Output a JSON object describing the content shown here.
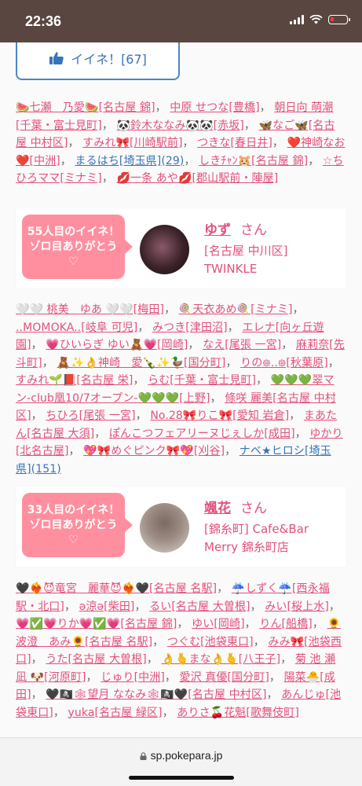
{
  "status": {
    "time": "22:36"
  },
  "like_button": {
    "label": "イイネ！[67]"
  },
  "list1": [
    {
      "text": "🍉七瀬　乃愛🍉[名古屋 錦]"
    },
    {
      "text": "中原 せつな[豊橋]"
    },
    {
      "text": "朝日向 萌潮[千葉・富士見町]"
    },
    {
      "text": "🐼鈴木ななみ🐼🐼[赤坂]"
    },
    {
      "text": "🦋なご🦋[名古屋 中村区]"
    },
    {
      "text": "すみれ🎀[川崎駅前]"
    },
    {
      "text": "つきな[春日井]"
    },
    {
      "text": "❤️神崎なお❤️[中洲]"
    },
    {
      "text": "まるはち[埼玉県](29)",
      "blue": true
    },
    {
      "text": "しきﾁｬﾝ🐹[名古屋 錦]"
    },
    {
      "text": "☆ちひろママ[ミナミ]"
    },
    {
      "text": "💋一条 あや💋[郡山駅前・陣屋]"
    }
  ],
  "card1": {
    "badge_line1": "55人目のイイネ！",
    "badge_line2": "ゾロ目ありがとう",
    "badge_heart": "♡",
    "name": "ゆず",
    "suffix": "さん",
    "shop": "[名古屋 中川区] TWINKLE"
  },
  "list2": [
    {
      "text": "🤍🤍 桃美　ゆあ 🤍🤍[梅田]"
    },
    {
      "text": "🍭天衣あめ🍭[ミナミ]"
    },
    {
      "text": "..MOMOKA..[岐阜 可児]"
    },
    {
      "text": "みつき[津田沼]"
    },
    {
      "text": "エレナ[向ヶ丘遊園]"
    },
    {
      "text": "💗ひいらぎ ゆい🧸💗[岡崎]"
    },
    {
      "text": "なえ[尾張 一宮]"
    },
    {
      "text": "麻莉奈[先斗町]"
    },
    {
      "text": "🧸✨👌神崎　愛🍾✨🦆[国分町]"
    },
    {
      "text": "りの᪥..᪥[秋葉原]"
    },
    {
      "text": "すみれ🌱📕[名古屋 栄]"
    },
    {
      "text": "らむ[千葉・富士見町]"
    },
    {
      "text": "💚💚💚翠マン-club凰10/7オープン-💚💚💚[上野]"
    },
    {
      "text": "條咲 麗美[名古屋 中村区]"
    },
    {
      "text": "ちひろ[尾張 一宮]"
    },
    {
      "text": "No.28🎀りこ🎀[愛知 岩倉]"
    },
    {
      "text": "まあたん[名古屋 大須]"
    },
    {
      "text": "ぽんこつフェアリーヌじぇしか[成田]"
    },
    {
      "text": "ゆかり[北名古屋]"
    },
    {
      "text": "💖🎀めぐピンク🎀💖[刈谷]"
    },
    {
      "text": "ナベ★ヒロシ[埼玉県](151)",
      "blue": true
    }
  ],
  "card2": {
    "badge_line1": "33人目のイイネ！",
    "badge_line2": "ゾロ目ありがとう",
    "badge_heart": "♡",
    "name": "颯花",
    "suffix": "さん",
    "shop": "[錦糸町] Cafe&Bar Merry 錦糸町店"
  },
  "list3": [
    {
      "text": "🖤❤️‍🔥😈竜宮　麗華😈❤️‍🔥🖤[名古屋 名駅]"
    },
    {
      "text": "☔️しずく☔️[西永福駅・北口]"
    },
    {
      "text": "ə涼ə[柴田]"
    },
    {
      "text": "るい[名古屋 大曽根]"
    },
    {
      "text": "みい[桜上水]"
    },
    {
      "text": "💗✅💗りか💗✅💗[名古屋 錦]"
    },
    {
      "text": "ゆい[岡崎]"
    },
    {
      "text": "りん[船橋]"
    },
    {
      "text": "🌻波澄　あみ🌻[名古屋 名駅]"
    },
    {
      "text": "つぐむ[池袋東口]"
    },
    {
      "text": "みみ🎀[池袋西口]"
    },
    {
      "text": "うた[名古屋 大曽根]"
    },
    {
      "text": "👌🫰まな👌🫰[八王子]"
    },
    {
      "text": "菊 池 瀬 凪 🐶[河原町]"
    },
    {
      "text": "じゅり[中洲]"
    },
    {
      "text": "愛沢 真優[国分町]"
    },
    {
      "text": "陽菜🐣[成田]"
    },
    {
      "text": "🖤🏴‍☠️🕸望月 ななみ🕸🏴‍☠️🖤[名古屋 中村区]"
    },
    {
      "text": "あんじゅ[池袋東口]"
    },
    {
      "text": "yuka[名古屋 緑区]"
    },
    {
      "text": "ありさ🍒花魁[歌舞伎町]"
    }
  ],
  "browser": {
    "url": "sp.pokepara.jp"
  },
  "colors": {
    "accent_pink": "#e2517b",
    "badge_pink": "#ff8f9f",
    "link_blue": "#3a74b8",
    "status_bar": "#5a4640"
  }
}
